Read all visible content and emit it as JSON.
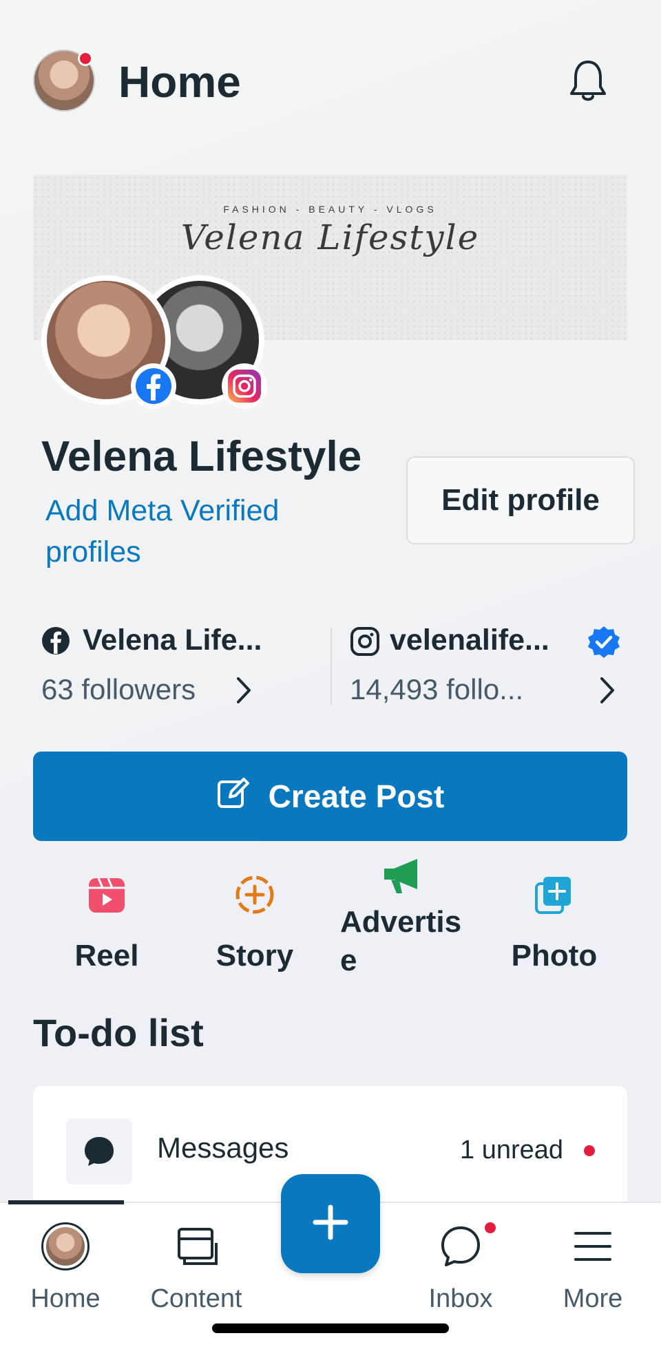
{
  "header": {
    "title": "Home",
    "avatar_icon": "profile-avatar",
    "notification_icon": "bell-icon"
  },
  "cover": {
    "tagline": "FASHION - BEAUTY - VLOGS",
    "script_title": "Velena Lifestyle"
  },
  "profile": {
    "name": "Velena Lifestyle",
    "verified_link": "Add Meta Verified profiles",
    "edit_button": "Edit profile"
  },
  "accounts": {
    "facebook": {
      "name": "Velena Life...",
      "followers": "63 followers"
    },
    "instagram": {
      "name": "velenalife...",
      "followers": "14,493 follo..."
    }
  },
  "create_post": {
    "label": "Create Post"
  },
  "shortcuts": [
    {
      "label": "Reel",
      "icon": "reel-icon",
      "color": "#f0506e"
    },
    {
      "label": "Story",
      "icon": "story-add-icon",
      "color": "#e07b1a"
    },
    {
      "label": "Advertise",
      "label_line1": "Advertis",
      "label_line2": "e",
      "icon": "megaphone-icon",
      "color": "#1f9d55"
    },
    {
      "label": "Photo",
      "icon": "photo-add-icon",
      "color": "#1fa6d6"
    }
  ],
  "todo": {
    "title": "To-do list",
    "items": [
      {
        "label": "Messages",
        "status": "1 unread",
        "icon": "chat-bubble-icon"
      }
    ]
  },
  "bottom_nav": {
    "items": [
      {
        "label": "Home",
        "icon": "avatar-icon",
        "active": true
      },
      {
        "label": "Content",
        "icon": "content-icon"
      },
      {
        "label": "Inbox",
        "icon": "chat-icon"
      },
      {
        "label": "More",
        "icon": "menu-icon"
      }
    ],
    "fab_icon": "plus-icon"
  },
  "colors": {
    "accent": "#0a78be",
    "text": "#1c2b33",
    "notification": "#e41e3f",
    "verified": "#1877f2"
  }
}
